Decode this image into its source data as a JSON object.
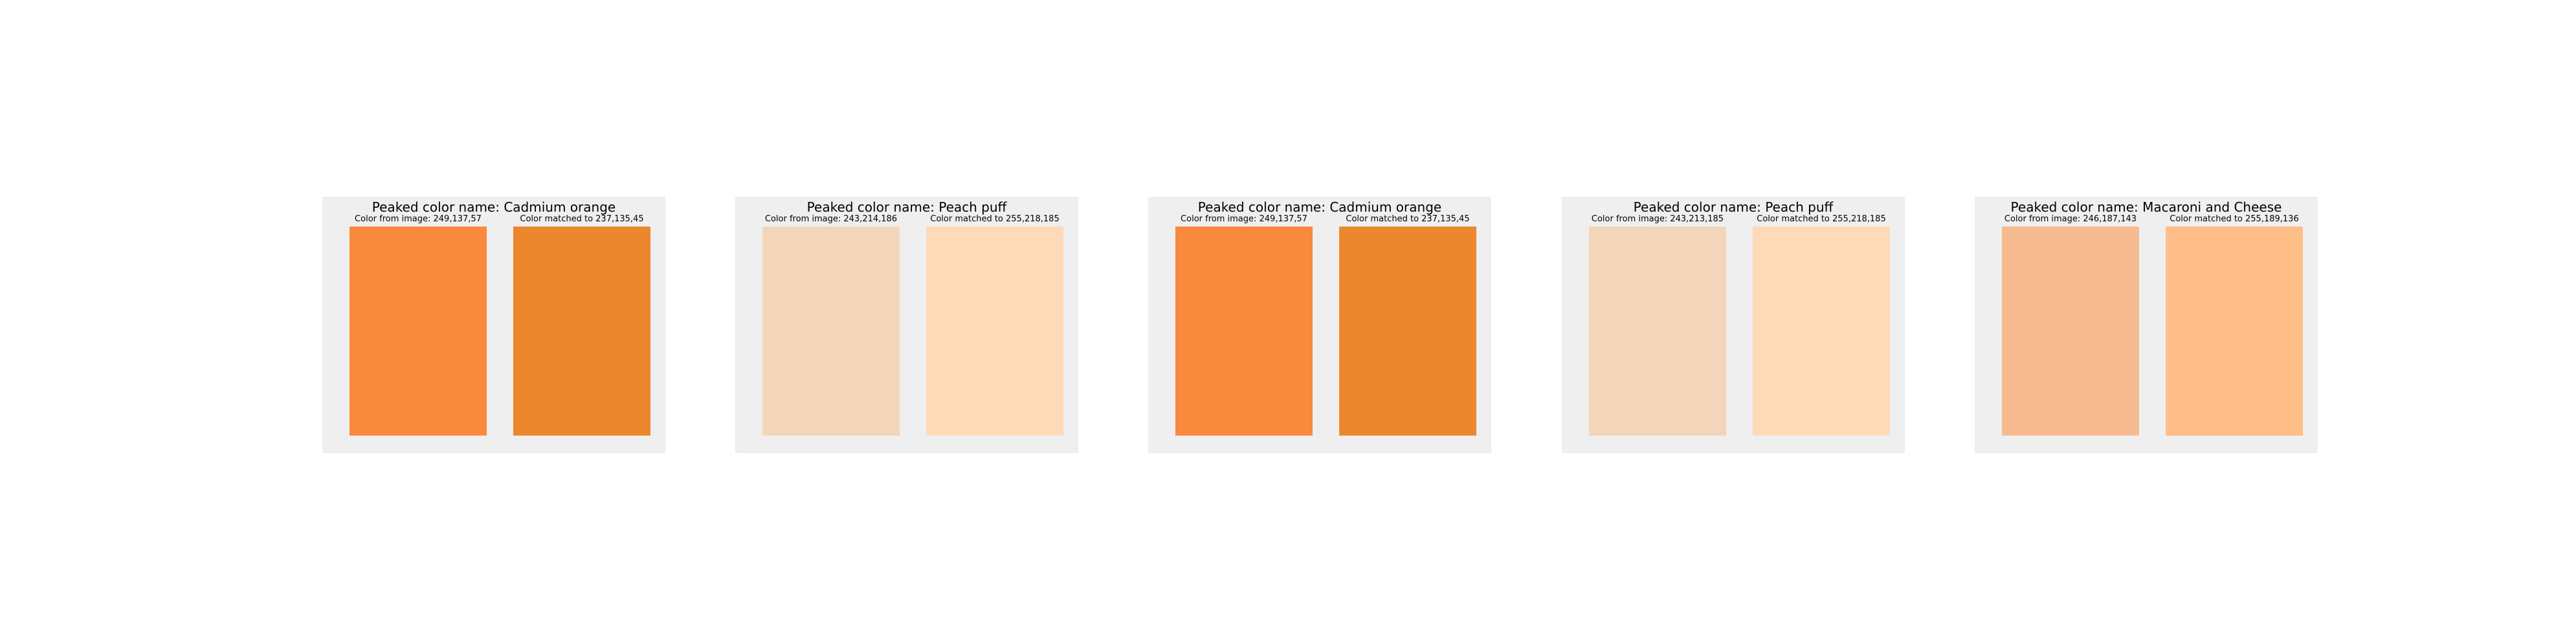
{
  "panels": [
    {
      "title": "Peaked color name: Cadmium orange",
      "image_label": "Color from image: 249,137,57",
      "matched_label": "Color matched to 237,135,45",
      "image_color": "#f9893d",
      "matched_color": "#ed872d"
    },
    {
      "title": "Peaked color name: Peach puff",
      "image_label": "Color from image: 243,214,186",
      "matched_label": "Color matched to 255,218,185",
      "image_color": "#f3d6ba",
      "matched_color": "#ffdab9"
    },
    {
      "title": "Peaked color name: Cadmium orange",
      "image_label": "Color from image: 249,137,57",
      "matched_label": "Color matched to 237,135,45",
      "image_color": "#f9893d",
      "matched_color": "#ed872d"
    },
    {
      "title": "Peaked color name: Peach puff",
      "image_label": "Color from image: 243,213,185",
      "matched_label": "Color matched to 255,218,185",
      "image_color": "#f3d5b9",
      "matched_color": "#ffdab9"
    },
    {
      "title": "Peaked color name: Macaroni and Cheese",
      "image_label": "Color from image: 246,187,143",
      "matched_label": "Color matched to 255,189,136",
      "image_color": "#f6bb8f",
      "matched_color": "#ffbd88"
    }
  ]
}
